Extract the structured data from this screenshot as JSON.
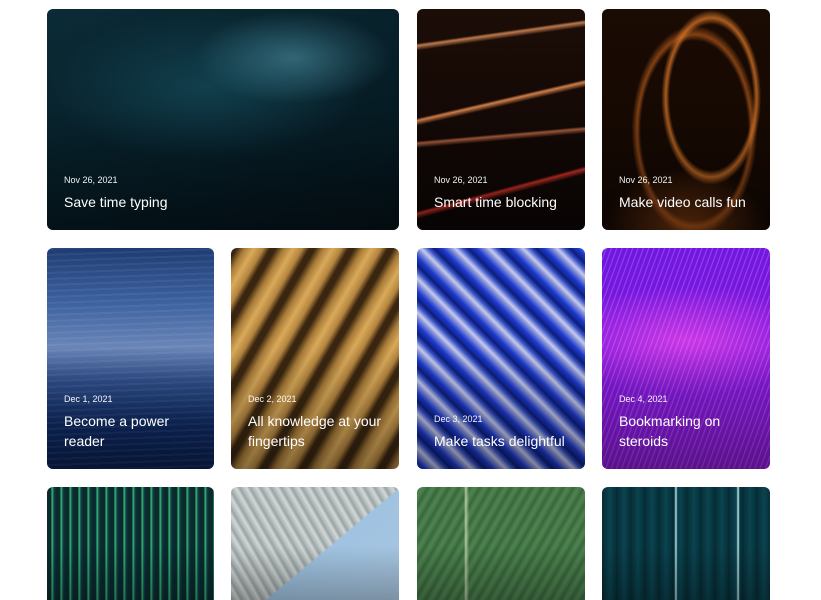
{
  "cards": [
    {
      "date": "Nov 26, 2021",
      "title": "Save time typing"
    },
    {
      "date": "Nov 26, 2021",
      "title": "Smart time blocking"
    },
    {
      "date": "Nov 26, 2021",
      "title": "Make video calls fun"
    },
    {
      "date": "Dec 1, 2021",
      "title": "Become a power reader"
    },
    {
      "date": "Dec 2, 2021",
      "title": "All knowledge at your fingertips"
    },
    {
      "date": "Dec 3, 2021",
      "title": "Make tasks delightful"
    },
    {
      "date": "Dec 4, 2021",
      "title": "Bookmarking on steroids"
    }
  ]
}
